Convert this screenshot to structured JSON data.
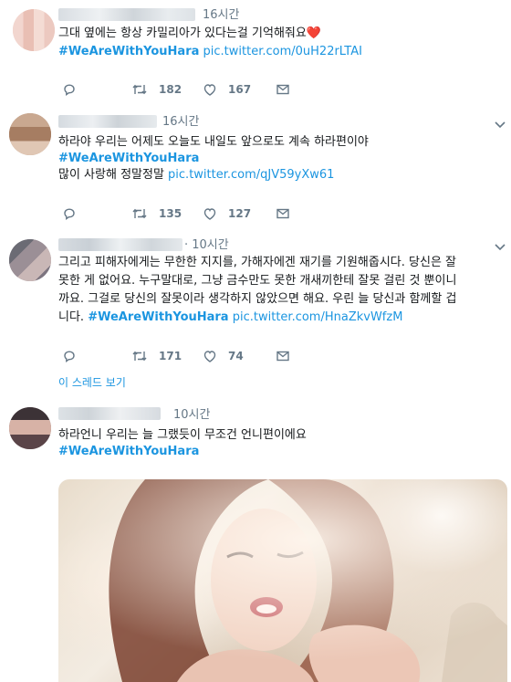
{
  "tweets": [
    {
      "time": "16시간",
      "text": "그대 옆에는 항상 카밀리아가 있다는걸 기억해줘요",
      "heart": "❤️",
      "hashtag": "#WeAreWithYouHara",
      "link": "pic.twitter.com/0uH22rLTAI",
      "retweets": "182",
      "likes": "167"
    },
    {
      "time": "16시간",
      "text": "하라야 우리는 어제도 오늘도 내일도 앞으로도 계속 하라편이야",
      "hashtag": "#WeAreWithYouHara",
      "text2": "많이 사랑해 정말정말",
      "link": "pic.twitter.com/qJV59yXw61",
      "retweets": "135",
      "likes": "127"
    },
    {
      "time": "10시간",
      "line1": "그리고 피해자에게는 무한한 지지를, 가해자에겐 재기를 기원해줍시다. 당신은 잘",
      "line2": "못한 게 없어요. 누구말대로, 그냥 금수만도 못한 개새끼한테 잘못 걸린 것 뿐이니",
      "line3": "까요. 그걸로 당신의 잘못이라 생각하지 않았으면 해요. 우린 늘 당신과 함께할 겁",
      "line4": "니다.",
      "hashtag": "#WeAreWithYouHara",
      "link": "pic.twitter.com/HnaZkvWfzM",
      "retweets": "171",
      "likes": "74",
      "thread": "이 스레드 보기"
    },
    {
      "time": "10시간",
      "text": "하라언니 우리는 늘 그랬듯이 무조건 언니편이에요",
      "hashtag": "#WeAreWithYouHara"
    }
  ],
  "icons": {
    "reply": "reply-icon",
    "retweet": "retweet-icon",
    "like": "heart-icon",
    "dm": "direct-message-icon",
    "more": "chevron-down-icon"
  },
  "colors": {
    "link": "#1b95e0",
    "muted": "#657786",
    "border": "#e6ecf0",
    "heart": "#e0245e"
  }
}
